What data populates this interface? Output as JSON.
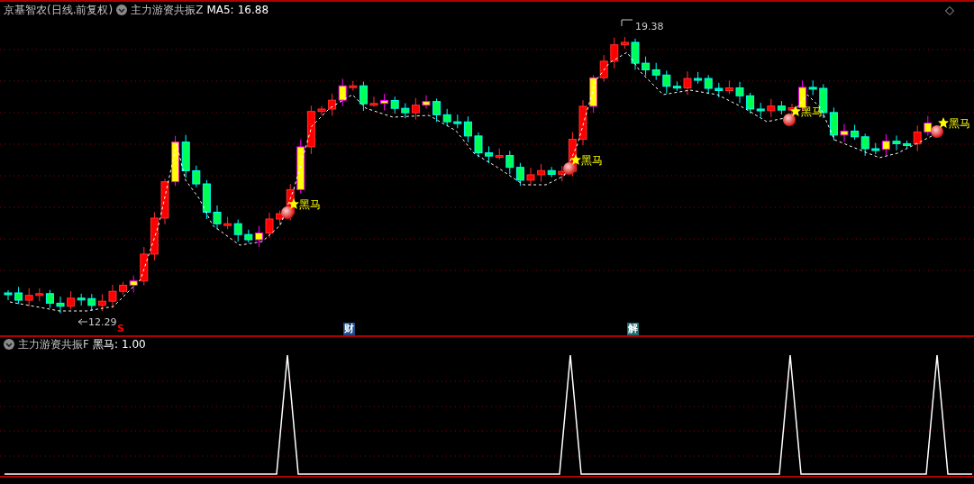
{
  "header": {
    "stock": "京基智农(日线.前复权)",
    "indicator": "主力游资共振Z",
    "ma_label": "MA5:",
    "ma_value": "16.88"
  },
  "main_chart": {
    "high_label": "19.38",
    "low_label": "12.29",
    "signals": [
      {
        "label": "黑马"
      },
      {
        "label": "黑马"
      },
      {
        "label": "黑马"
      },
      {
        "label": "黑马"
      }
    ],
    "event_markers": [
      {
        "label": "S",
        "kind": "text",
        "color": "#ff0000"
      },
      {
        "label": "财",
        "kind": "badge",
        "color": "#1e4a8a"
      },
      {
        "label": "解",
        "kind": "badge",
        "color": "#1d6b70"
      }
    ]
  },
  "sub_panel": {
    "indicator": "主力游资共振F",
    "value_label": "黑马:",
    "value": "1.00"
  }
}
